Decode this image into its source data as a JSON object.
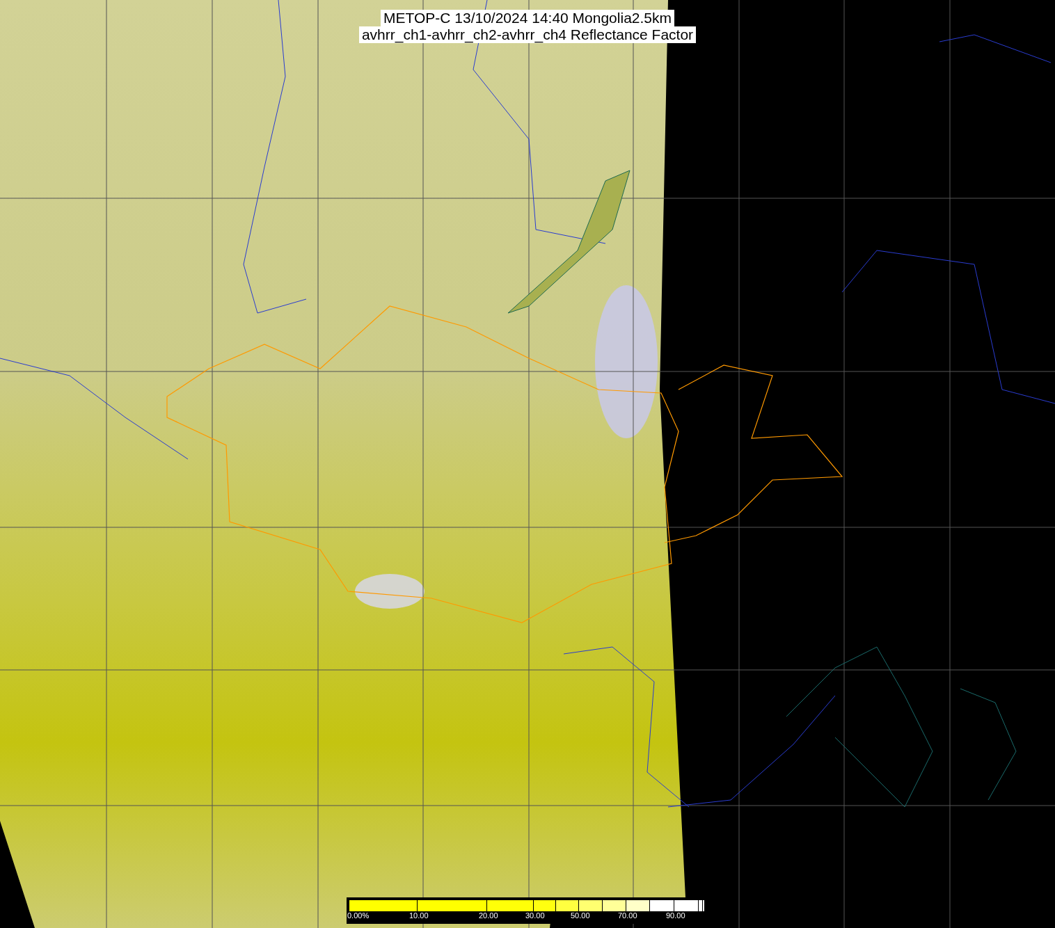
{
  "title": {
    "lines": [
      "METOP-C 13/10/2024 14:40 Mongolia2.5km",
      "avhrr_ch1-avhrr_ch2-avhrr_ch4 Reflectance Factor"
    ]
  },
  "colorbar": {
    "ticks": [
      "0.00%",
      "10.00",
      "20.00",
      "30.00",
      "50.00",
      "70.00",
      "90.00"
    ]
  }
}
